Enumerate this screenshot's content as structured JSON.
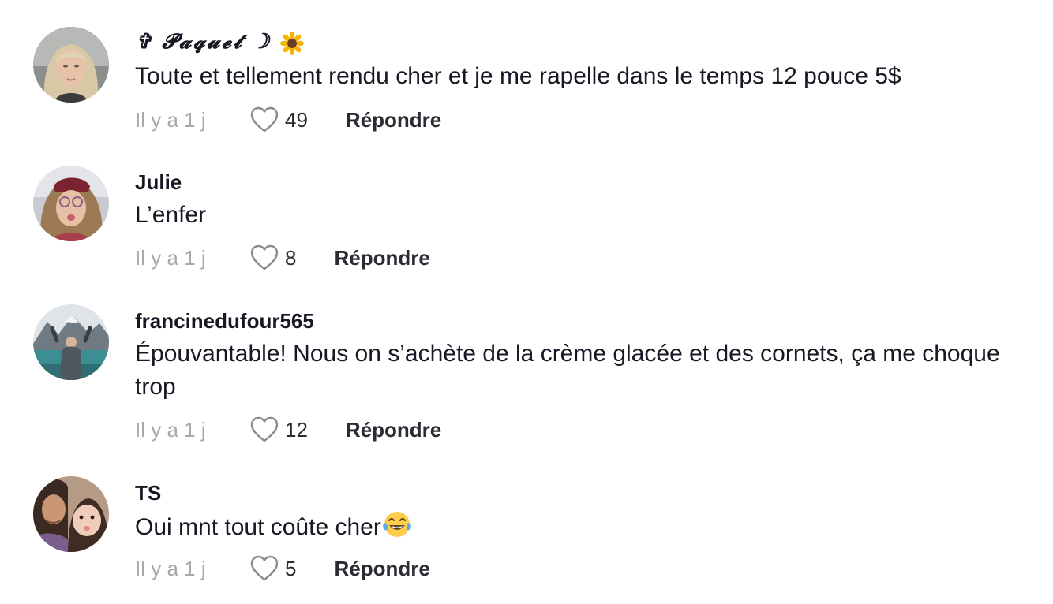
{
  "comments": [
    {
      "username": "✞ 𝓟𝓪𝓺𝓾𝓮𝓽 ☽",
      "flower_icon": "sunflower-emoji",
      "text": "Toute et tellement rendu cher et je me rapelle dans le temps 12 pouce 5$",
      "time": "Il y a 1 j",
      "likes": "49",
      "reply_label": "Répondre"
    },
    {
      "username": "Julie",
      "text": "L’enfer",
      "time": "Il y a 1 j",
      "likes": "8",
      "reply_label": "Répondre"
    },
    {
      "username": "francinedufour565",
      "text": "Épouvantable! Nous on s’achète de la crème glacée et des cornets, ça me choque trop",
      "time": "Il y a 1 j",
      "likes": "12",
      "reply_label": "Répondre"
    },
    {
      "username": "TS",
      "text": "Oui mnt tout coûte cher",
      "emoji_icon": "face-with-tears-of-joy-emoji",
      "time": "Il y a 1 j",
      "likes": "5",
      "reply_label": "Répondre"
    }
  ],
  "colors": {
    "text": "#161823",
    "muted": "#a7a8ad",
    "action": "#2b2c33"
  }
}
